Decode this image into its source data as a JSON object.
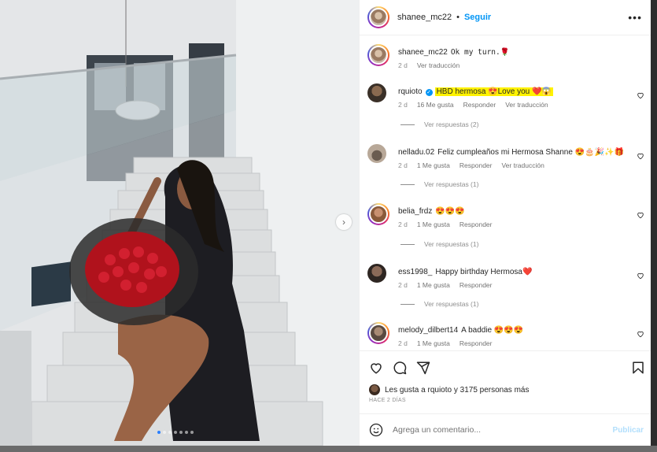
{
  "post": {
    "username": "shanee_mc22",
    "follow_label": "Seguir",
    "separator": "•",
    "more_label": "•••"
  },
  "caption": {
    "username": "shanee_mc22",
    "text": "Ok my turn.🌹",
    "time": "2 d",
    "translate": "Ver traducción"
  },
  "comments": [
    {
      "username": "rquioto",
      "verified": true,
      "text": "HBD hermosa 😍Love you ❤️😱",
      "time": "2 d",
      "likes": "16 Me gusta",
      "reply": "Responder",
      "translate": "Ver traducción",
      "replies": "Ver respuestas (2)"
    },
    {
      "username": "nelladu.02",
      "text": "Feliz cumpleaños mi Hermosa Shanne 😍🎂🎉✨🎁",
      "time": "2 d",
      "likes": "1 Me gusta",
      "reply": "Responder",
      "translate": "Ver traducción",
      "replies": "Ver respuestas (1)"
    },
    {
      "username": "belia_frdz",
      "text": "😍😍😍",
      "time": "2 d",
      "likes": "1 Me gusta",
      "reply": "Responder",
      "replies": "Ver respuestas (1)"
    },
    {
      "username": "ess1998_",
      "text": "Happy birthday Hermosa❤️",
      "time": "2 d",
      "likes": "1 Me gusta",
      "reply": "Responder",
      "replies": "Ver respuestas (1)"
    },
    {
      "username": "melody_dilbert14",
      "text": "A baddie 😍😍😍",
      "time": "2 d",
      "likes": "1 Me gusta",
      "reply": "Responder"
    }
  ],
  "likes_line": {
    "prefix": "Les gusta a",
    "user": "rquioto",
    "suffix": "y 3175 personas más"
  },
  "posted_ago": "HACE 2 DÍAS",
  "comment_box": {
    "placeholder": "Agrega un comentario...",
    "post_label": "Publicar"
  },
  "carousel": {
    "count": 7,
    "active_index": 0
  },
  "colors": {
    "accent": "#0095f6",
    "highlight": "#fff200",
    "post_disabled": "#b2dffc"
  }
}
